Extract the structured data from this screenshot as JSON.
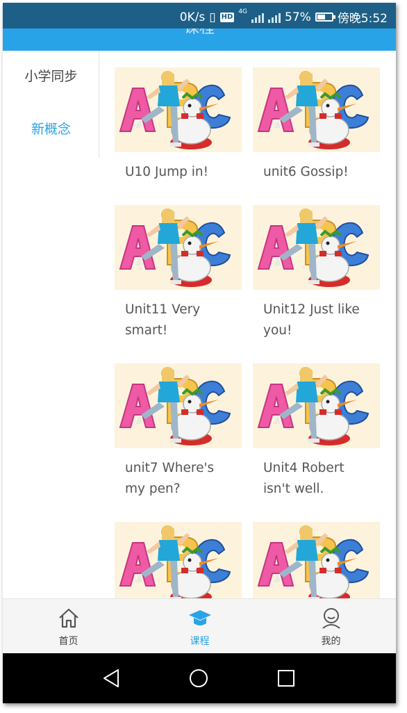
{
  "status_bar": {
    "network_speed": "0K/s",
    "hd_badge": "HD",
    "network_type": "4G",
    "battery": "57%",
    "battery_level": 0.57,
    "time": "傍晚5:52"
  },
  "header": {
    "title": "课程",
    "color": "#29a3e8"
  },
  "sidebar": {
    "items": [
      {
        "label": "小学同步",
        "active": false
      },
      {
        "label": "新概念",
        "active": true
      }
    ]
  },
  "courses": [
    {
      "title": "U10 Jump in!"
    },
    {
      "title": "unit6 Gossip!"
    },
    {
      "title": "Unit11 Very smart!"
    },
    {
      "title": "Unit12 Just like you!"
    },
    {
      "title": "unit7 Where's my pen?"
    },
    {
      "title": "Unit4 Robert isn't well."
    },
    {
      "title": ""
    },
    {
      "title": ""
    }
  ],
  "tabbar": {
    "tabs": [
      {
        "label": "首页",
        "icon": "home-icon",
        "active": false
      },
      {
        "label": "课程",
        "icon": "graduation-cap-icon",
        "active": true
      },
      {
        "label": "我的",
        "icon": "user-icon",
        "active": false
      }
    ]
  },
  "navbar": {
    "buttons": [
      "back-icon",
      "home-circle-icon",
      "recents-icon"
    ]
  }
}
